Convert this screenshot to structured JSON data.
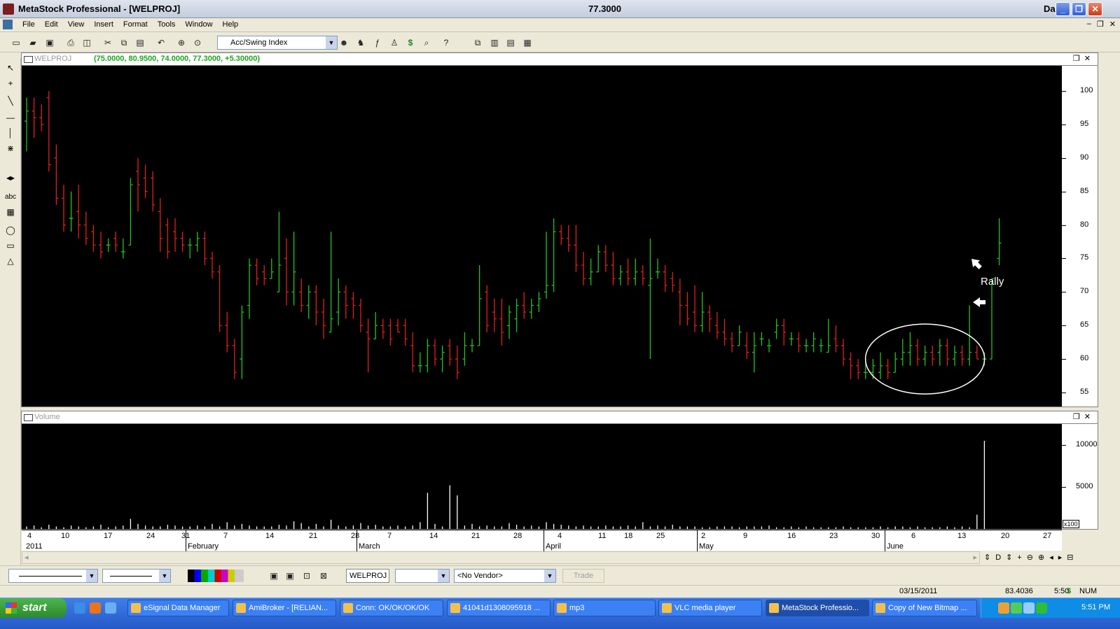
{
  "window": {
    "title": "MetaStock Professional - [WELPROJ]",
    "price": "77.3000",
    "period": "Daily",
    "controls": [
      "_",
      "❐",
      "✕"
    ]
  },
  "menu": [
    "File",
    "Edit",
    "View",
    "Insert",
    "Format",
    "Tools",
    "Window",
    "Help"
  ],
  "toolbar": {
    "indicator_select": "Acc/Swing Index"
  },
  "price_panel": {
    "label": "WELPROJ",
    "ohlc": "(75.0000, 80.9500, 74.0000, 77.3000, +5.30000)",
    "y_ticks": [
      "100",
      "95",
      "90",
      "85",
      "80",
      "75",
      "70",
      "65",
      "60",
      "55"
    ],
    "annotation": "Rally"
  },
  "volume_panel": {
    "label": "Volume",
    "y_ticks": [
      "10000",
      "5000"
    ],
    "scale_label": "x100"
  },
  "x_axis": {
    "dates": [
      "4",
      "10",
      "17",
      "24",
      "31",
      "7",
      "14",
      "21",
      "28",
      "7",
      "14",
      "21",
      "28",
      "4",
      "11",
      "18",
      "25",
      "2",
      "9",
      "16",
      "23",
      "30",
      "6",
      "13",
      "20",
      "27"
    ],
    "months": [
      "2011",
      "February",
      "March",
      "April",
      "May",
      "June"
    ]
  },
  "bottom": {
    "symbol": "WELPROJ",
    "vendor": "<No Vendor>",
    "trade_button": "Trade"
  },
  "status": {
    "date": "03/15/2011",
    "value": "83.4036",
    "time": "5:50",
    "currency": "$",
    "num": "NUM"
  },
  "taskbar": {
    "start": "start",
    "items": [
      "eSignal Data Manager",
      "AmiBroker - [RELIAN...",
      "Conn: OK/OK/OK/OK",
      "41041d1308095918 ...",
      "mp3",
      "VLC media player",
      "MetaStock Professio...",
      "Copy of New Bitmap ..."
    ],
    "clock": "5:51 PM"
  },
  "chart_data": {
    "type": "ohlc_bar",
    "symbol": "WELPROJ",
    "ylim": [
      55,
      101
    ],
    "volume_ylim": [
      0,
      11000
    ],
    "bars": [
      [
        95.5,
        99,
        91,
        97
      ],
      [
        97,
        99,
        93,
        96
      ],
      [
        96,
        98,
        94,
        95
      ],
      [
        99,
        100,
        88,
        89
      ],
      [
        90,
        92,
        83,
        84
      ],
      [
        84,
        86,
        79,
        80
      ],
      [
        81,
        85,
        79,
        81
      ],
      [
        82,
        86,
        78,
        80
      ],
      [
        80,
        82,
        77,
        78
      ],
      [
        79,
        80,
        76,
        77
      ],
      [
        77,
        79,
        75,
        76
      ],
      [
        77,
        78,
        76,
        77
      ],
      [
        78,
        79,
        76,
        77
      ],
      [
        76,
        78,
        75,
        76
      ],
      [
        77,
        87,
        77,
        86
      ],
      [
        88,
        90,
        82,
        86
      ],
      [
        87,
        89,
        84,
        85
      ],
      [
        87,
        88,
        82,
        83
      ],
      [
        82,
        84,
        76,
        78
      ],
      [
        80,
        81,
        75,
        76
      ],
      [
        79,
        81,
        76,
        78
      ],
      [
        78,
        79,
        76,
        77
      ],
      [
        77,
        78,
        75,
        77
      ],
      [
        77,
        79,
        76,
        78
      ],
      [
        78,
        79,
        74,
        75
      ],
      [
        75,
        76,
        72,
        73
      ],
      [
        73,
        74,
        64,
        65
      ],
      [
        65,
        67,
        61,
        62
      ],
      [
        62,
        63,
        57,
        58
      ],
      [
        60,
        68,
        57,
        67
      ],
      [
        68,
        75,
        66,
        74
      ],
      [
        74,
        75,
        71,
        72
      ],
      [
        73,
        74,
        71,
        72
      ],
      [
        72,
        75,
        72,
        73
      ],
      [
        70,
        82,
        70,
        74
      ],
      [
        75,
        78,
        68,
        70
      ],
      [
        70,
        79,
        68,
        73
      ],
      [
        70,
        72,
        67,
        68
      ],
      [
        68,
        71,
        66,
        70
      ],
      [
        70,
        71,
        65,
        67
      ],
      [
        67,
        69,
        63,
        65
      ],
      [
        64,
        79,
        64,
        66
      ],
      [
        67,
        72,
        65,
        70
      ],
      [
        70,
        71,
        66,
        68
      ],
      [
        69,
        70,
        66,
        68
      ],
      [
        68,
        69,
        64,
        65
      ],
      [
        64,
        66,
        58,
        63
      ],
      [
        63,
        67,
        63,
        65
      ],
      [
        65,
        66,
        63,
        64
      ],
      [
        65,
        66,
        62,
        63
      ],
      [
        65,
        66,
        64,
        64
      ],
      [
        65,
        66,
        62,
        63
      ],
      [
        62,
        64,
        58,
        59
      ],
      [
        59,
        61,
        58,
        59
      ],
      [
        59,
        63,
        58,
        62
      ],
      [
        62,
        63,
        59,
        60
      ],
      [
        60,
        62,
        58,
        61
      ],
      [
        62,
        63,
        59,
        60
      ],
      [
        60,
        62,
        57,
        58
      ],
      [
        60,
        64,
        59,
        62
      ],
      [
        62,
        63,
        61,
        62
      ],
      [
        62,
        74,
        62,
        69
      ],
      [
        70,
        71,
        64,
        65
      ],
      [
        67,
        69,
        64,
        66
      ],
      [
        66,
        69,
        62,
        64
      ],
      [
        65,
        68,
        63,
        67
      ],
      [
        66,
        69,
        64,
        68
      ],
      [
        68,
        70,
        66,
        67
      ],
      [
        67,
        69,
        66,
        68
      ],
      [
        68,
        70,
        67,
        69
      ],
      [
        70,
        79,
        69,
        71
      ],
      [
        71,
        81,
        70,
        79
      ],
      [
        79,
        80,
        77,
        78
      ],
      [
        78,
        80,
        76,
        77
      ],
      [
        77,
        80,
        73,
        74
      ],
      [
        74,
        76,
        71,
        72
      ],
      [
        72,
        75,
        71,
        73
      ],
      [
        73,
        77,
        73,
        76
      ],
      [
        76,
        77,
        73,
        74
      ],
      [
        74,
        76,
        71,
        72
      ],
      [
        72,
        74,
        71,
        73
      ],
      [
        73,
        75,
        71,
        72
      ],
      [
        72,
        75,
        71,
        73
      ],
      [
        73,
        74,
        71,
        72
      ],
      [
        71,
        78,
        60,
        72
      ],
      [
        73,
        75,
        72,
        73
      ],
      [
        73,
        74,
        70,
        71
      ],
      [
        72,
        73,
        70,
        71
      ],
      [
        70,
        72,
        65,
        68
      ],
      [
        68,
        70,
        65,
        66
      ],
      [
        67,
        71,
        64,
        65
      ],
      [
        65,
        70,
        64,
        67
      ],
      [
        67,
        68,
        64,
        66
      ],
      [
        65,
        67,
        63,
        64
      ],
      [
        64,
        66,
        62,
        63
      ],
      [
        63,
        64,
        61,
        62
      ],
      [
        62,
        65,
        62,
        64
      ],
      [
        62,
        64,
        60,
        61
      ],
      [
        61,
        64,
        58,
        62
      ],
      [
        63,
        64,
        62,
        63
      ],
      [
        62,
        63,
        61,
        62
      ],
      [
        64,
        66,
        63,
        65
      ],
      [
        65,
        66,
        62,
        64
      ],
      [
        63,
        64,
        62,
        63
      ],
      [
        63,
        64,
        61,
        62
      ],
      [
        62,
        63,
        61,
        62
      ],
      [
        62,
        64,
        61,
        63
      ],
      [
        62,
        63,
        61,
        62
      ],
      [
        61,
        66,
        61,
        62
      ],
      [
        63,
        65,
        61,
        62
      ],
      [
        62,
        63,
        59,
        60
      ],
      [
        60,
        61,
        57,
        59
      ],
      [
        59,
        60,
        57,
        58
      ],
      [
        58,
        60,
        57,
        58
      ],
      [
        58,
        60,
        57,
        59
      ],
      [
        58,
        61,
        57,
        59
      ],
      [
        59,
        60,
        57,
        58
      ],
      [
        58,
        61,
        58,
        60
      ],
      [
        60,
        63,
        59,
        61
      ],
      [
        61,
        64,
        59,
        62
      ],
      [
        62,
        63,
        59,
        60
      ],
      [
        60,
        62,
        59,
        61
      ],
      [
        61,
        62,
        59,
        60
      ],
      [
        61,
        63,
        59,
        62
      ],
      [
        62,
        63,
        59,
        60
      ],
      [
        60,
        62,
        59,
        61
      ],
      [
        61,
        62,
        59,
        60
      ],
      [
        60,
        68,
        59,
        61
      ],
      [
        61,
        62,
        60,
        60
      ],
      [
        60,
        61,
        59,
        60
      ],
      [
        60,
        72,
        60,
        72
      ],
      [
        75,
        81,
        74,
        77.3
      ]
    ],
    "volume": [
      300,
      400,
      200,
      500,
      300,
      200,
      400,
      300,
      200,
      300,
      500,
      200,
      300,
      400,
      1200,
      600,
      400,
      300,
      300,
      500,
      400,
      300,
      300,
      400,
      300,
      600,
      300,
      800,
      400,
      600,
      400,
      300,
      300,
      300,
      500,
      400,
      900,
      700,
      300,
      600,
      300,
      1100,
      400,
      300,
      400,
      700,
      400,
      500,
      300,
      300,
      400,
      300,
      400,
      800,
      4300,
      600,
      300,
      5200,
      4000,
      400,
      600,
      300,
      400,
      300,
      300,
      700,
      500,
      300,
      400,
      300,
      800,
      600,
      500,
      400,
      300,
      400,
      300,
      300,
      400,
      300,
      300,
      400,
      300,
      800,
      300,
      400,
      300,
      500,
      300,
      300,
      300,
      200,
      200,
      300,
      300,
      300,
      200,
      300,
      300,
      300,
      400,
      200,
      200,
      300,
      200,
      300,
      200,
      200,
      200,
      200,
      300,
      200,
      200,
      200,
      200,
      300,
      200,
      300,
      300,
      200,
      300,
      200,
      200,
      200,
      300,
      200,
      300,
      200,
      1700,
      10500
    ]
  }
}
